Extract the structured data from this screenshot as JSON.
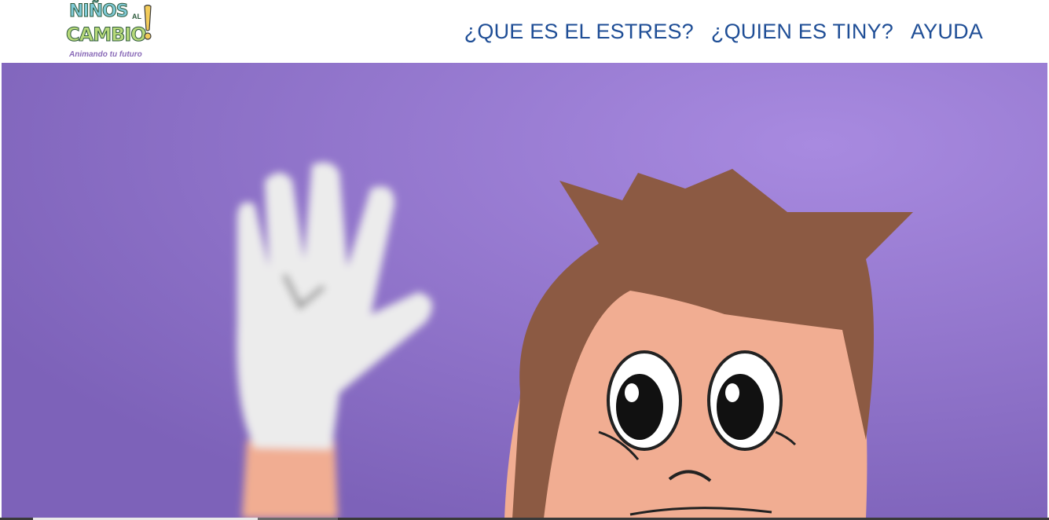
{
  "header": {
    "logo": {
      "line1": "NIÑOS",
      "connector": "AL",
      "line2": "CAMBIO",
      "tagline": "Animando tu futuro"
    },
    "nav": [
      {
        "label": "¿QUE ES EL ESTRES?"
      },
      {
        "label": "¿QUIEN ES TINY?"
      },
      {
        "label": "AYUDA"
      }
    ]
  },
  "video": {
    "progress_fraction": 0.21,
    "colors": {
      "background": "#8a6cc4",
      "hair": "#8c5a43",
      "skin": "#f1ad92",
      "glove": "#f2f2f2"
    }
  },
  "colors": {
    "nav_link": "#1f4e96",
    "logo_cyan": "#7fc9d6",
    "logo_green": "#b7d97a",
    "tagline": "#8a6bb8"
  }
}
